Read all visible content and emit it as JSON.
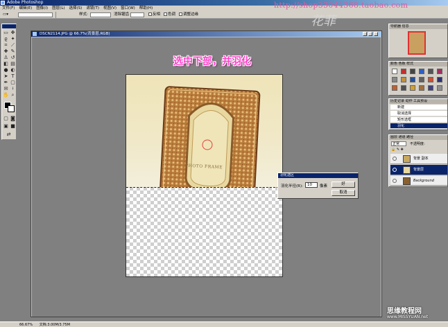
{
  "app": {
    "title": "Adobe Photoshop",
    "watermark": "http://shop33044368.taobao.com",
    "watermark_brand": "花菲",
    "menu": [
      "文件(F)",
      "编辑(E)",
      "图像(I)",
      "图层(L)",
      "选择(S)",
      "滤镜(T)",
      "视图(V)",
      "窗口(W)",
      "帮助(H)"
    ]
  },
  "options": {
    "mode_label": "样式:",
    "feather_label": "羽化:",
    "antialias_label": "消除锯齿",
    "check1": "反相",
    "check2": "色调",
    "check3": "调整边缘"
  },
  "document": {
    "title": "DSCN2114.JPG @ 66.7%(背景层,RGB)",
    "heading": "选中下部，并羽化",
    "frame_text": "PHOTO FRAME"
  },
  "feather_dialog": {
    "title": "羽化选区",
    "label": "羽化半径(R):",
    "value": "10",
    "unit": "像素",
    "ok": "好",
    "cancel": "取消"
  },
  "panels": {
    "navigator_tabs": "导航器 信息",
    "swatches_tabs": "颜色 色板 样式",
    "history_tabs": "历史记录 动作 工具预设",
    "history_items": [
      "新建",
      "取消选择",
      "矩形选框",
      "羽化"
    ],
    "layers_tabs": "图层 通道 路径",
    "layers_mode": "正常",
    "layers_opacity": "不透明度:",
    "layers": [
      {
        "name": "背景 副本"
      },
      {
        "name": "背景层"
      },
      {
        "name": "Background"
      }
    ]
  },
  "status": {
    "zoom": "66.67%",
    "doc": "文档:3.00M/3.75M"
  },
  "brand": {
    "line1": "思缘教程网",
    "line2": "www.MISSYUAN.net"
  },
  "colors": {
    "accent": "#0a246a",
    "heading": "#ff40c8"
  }
}
